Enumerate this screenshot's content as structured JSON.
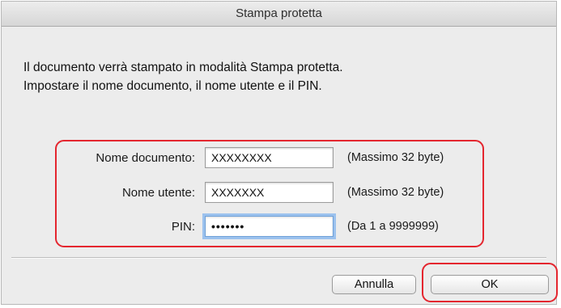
{
  "dialog": {
    "title": "Stampa protetta",
    "message_line1": "Il documento verrà stampato in modalità Stampa protetta.",
    "message_line2": "Impostare il nome documento, il nome utente e il PIN."
  },
  "fields": {
    "document_name": {
      "label": "Nome documento:",
      "value": "XXXXXXXX",
      "hint": "(Massimo 32 byte)"
    },
    "user_name": {
      "label": "Nome utente:",
      "value": "XXXXXXX",
      "hint": "(Massimo 32 byte)"
    },
    "pin": {
      "label": "PIN:",
      "value": "•••••••",
      "hint": "(Da 1 a 9999999)"
    }
  },
  "buttons": {
    "cancel_label": "Annulla",
    "ok_label": "OK"
  },
  "colors": {
    "highlight": "#e4262f",
    "focus_ring": "#9cc2ee"
  }
}
